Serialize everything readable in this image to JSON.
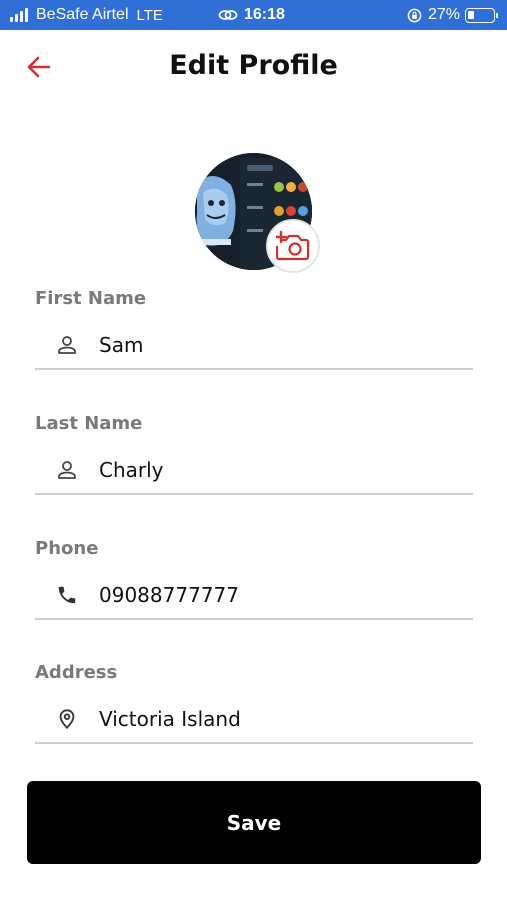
{
  "status_bar": {
    "carrier": "BeSafe Airtel",
    "network": "LTE",
    "time": "16:18",
    "battery": "27%",
    "battery_level": 0.27,
    "icons": [
      "signal-icon",
      "link-icon",
      "orientation-lock-icon",
      "battery-icon"
    ]
  },
  "header": {
    "title": "Edit Profile",
    "back_icon": "arrow-left-icon",
    "accent_color": "#d32f2f"
  },
  "avatar": {
    "camera_icon": "camera-plus-icon"
  },
  "form": {
    "first_name": {
      "label": "First Name",
      "value": "Sam",
      "icon": "person-icon"
    },
    "last_name": {
      "label": "Last Name",
      "value": "Charly",
      "icon": "person-icon"
    },
    "phone": {
      "label": "Phone",
      "value": "09088777777",
      "icon": "phone-icon"
    },
    "address": {
      "label": "Address",
      "value": "Victoria Island",
      "icon": "location-pin-icon"
    }
  },
  "save_label": "Save"
}
